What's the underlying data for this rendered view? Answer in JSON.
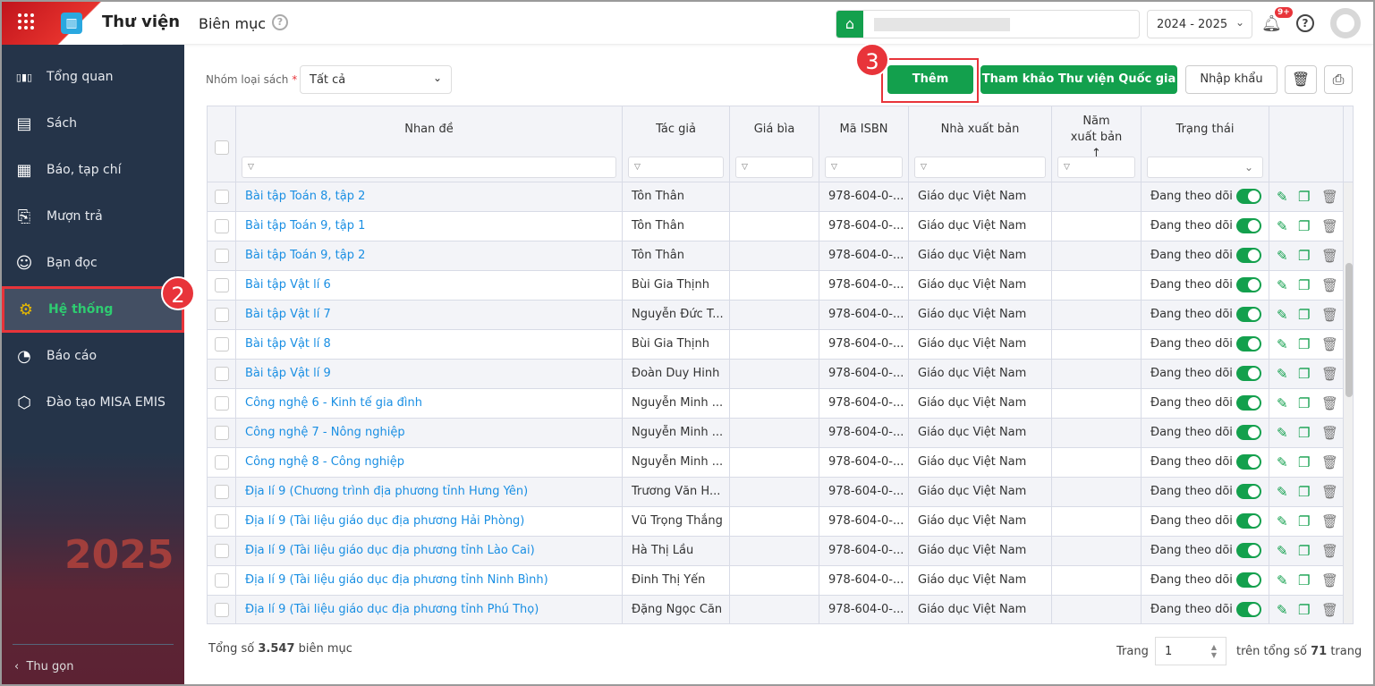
{
  "header": {
    "app_title": "Thư viện",
    "page_title": "Biên mục",
    "school_year": "2024 - 2025",
    "notification_badge": "9+"
  },
  "sidebar": {
    "items": [
      {
        "label": "Tổng quan",
        "icon": "chart-bars-icon"
      },
      {
        "label": "Sách",
        "icon": "book-icon"
      },
      {
        "label": "Báo, tạp chí",
        "icon": "newspaper-icon"
      },
      {
        "label": "Mượn trả",
        "icon": "borrow-icon"
      },
      {
        "label": "Bạn đọc",
        "icon": "reader-icon"
      },
      {
        "label": "Hệ thống",
        "icon": "gear-icon",
        "active": true
      },
      {
        "label": "Báo cáo",
        "icon": "pie-chart-icon"
      },
      {
        "label": "Đào tạo MISA EMIS",
        "icon": "cube-icon"
      }
    ],
    "collapse_label": "Thu gọn"
  },
  "steps": {
    "two": "2",
    "three": "3"
  },
  "toolbar": {
    "filter_label": "Nhóm loại sách",
    "required_mark": "*",
    "filter_value": "Tất cả",
    "add_label": "Thêm",
    "reference_label": "Tham khảo Thư viện Quốc gia",
    "import_label": "Nhập khẩu"
  },
  "table": {
    "columns": [
      "Nhan đề",
      "Tác giả",
      "Giá bìa",
      "Mã ISBN",
      "Nhà xuất bản",
      "Năm xuất bản ↑",
      "Trạng thái"
    ],
    "rows": [
      {
        "title": "Bài tập Toán 8, tập 2",
        "author": "Tôn Thân",
        "price": "",
        "isbn": "978-604-0-...",
        "publisher": "Giáo dục Việt Nam",
        "year": "",
        "status": "Đang theo dõi"
      },
      {
        "title": "Bài tập Toán 9, tập 1",
        "author": "Tôn Thân",
        "price": "",
        "isbn": "978-604-0-...",
        "publisher": "Giáo dục Việt Nam",
        "year": "",
        "status": "Đang theo dõi"
      },
      {
        "title": "Bài tập Toán 9, tập 2",
        "author": "Tôn Thân",
        "price": "",
        "isbn": "978-604-0-...",
        "publisher": "Giáo dục Việt Nam",
        "year": "",
        "status": "Đang theo dõi"
      },
      {
        "title": "Bài tập Vật lí 6",
        "author": "Bùi Gia Thịnh",
        "price": "",
        "isbn": "978-604-0-...",
        "publisher": "Giáo dục Việt Nam",
        "year": "",
        "status": "Đang theo dõi"
      },
      {
        "title": "Bài tập Vật lí 7",
        "author": "Nguyễn Đức T...",
        "price": "",
        "isbn": "978-604-0-...",
        "publisher": "Giáo dục Việt Nam",
        "year": "",
        "status": "Đang theo dõi"
      },
      {
        "title": "Bài tập Vật lí 8",
        "author": "Bùi Gia Thịnh",
        "price": "",
        "isbn": "978-604-0-...",
        "publisher": "Giáo dục Việt Nam",
        "year": "",
        "status": "Đang theo dõi"
      },
      {
        "title": "Bài tập Vật lí 9",
        "author": "Đoàn Duy Hinh",
        "price": "",
        "isbn": "978-604-0-...",
        "publisher": "Giáo dục Việt Nam",
        "year": "",
        "status": "Đang theo dõi"
      },
      {
        "title": "Công nghệ 6 - Kinh tế gia đình",
        "author": "Nguyễn Minh ...",
        "price": "",
        "isbn": "978-604-0-...",
        "publisher": "Giáo dục Việt Nam",
        "year": "",
        "status": "Đang theo dõi"
      },
      {
        "title": "Công nghệ 7 - Nông nghiệp",
        "author": "Nguyễn Minh ...",
        "price": "",
        "isbn": "978-604-0-...",
        "publisher": "Giáo dục Việt Nam",
        "year": "",
        "status": "Đang theo dõi"
      },
      {
        "title": "Công nghệ 8 - Công nghiệp",
        "author": "Nguyễn Minh ...",
        "price": "",
        "isbn": "978-604-0-...",
        "publisher": "Giáo dục Việt Nam",
        "year": "",
        "status": "Đang theo dõi"
      },
      {
        "title": "Địa lí 9 (Chương trình địa phương tỉnh Hưng Yên)",
        "author": "Trương Văn H...",
        "price": "",
        "isbn": "978-604-0-...",
        "publisher": "Giáo dục Việt Nam",
        "year": "",
        "status": "Đang theo dõi"
      },
      {
        "title": "Địa lí 9 (Tài liệu giáo dục địa phương Hải Phòng)",
        "author": "Vũ Trọng Thắng",
        "price": "",
        "isbn": "978-604-0-...",
        "publisher": "Giáo dục Việt Nam",
        "year": "",
        "status": "Đang theo dõi"
      },
      {
        "title": "Địa lí 9 (Tài liệu giáo dục địa phương tỉnh Lào Cai)",
        "author": "Hà Thị Lầu",
        "price": "",
        "isbn": "978-604-0-...",
        "publisher": "Giáo dục Việt Nam",
        "year": "",
        "status": "Đang theo dõi"
      },
      {
        "title": "Địa lí 9 (Tài liệu giáo dục địa phương tỉnh Ninh Bình)",
        "author": "Đinh Thị Yến",
        "price": "",
        "isbn": "978-604-0-...",
        "publisher": "Giáo dục Việt Nam",
        "year": "",
        "status": "Đang theo dõi"
      },
      {
        "title": "Địa lí 9 (Tài liệu giáo dục địa phương tỉnh Phú Thọ)",
        "author": "Đặng Ngọc Căn",
        "price": "",
        "isbn": "978-604-0-...",
        "publisher": "Giáo dục Việt Nam",
        "year": "",
        "status": "Đang theo dõi"
      }
    ]
  },
  "footer": {
    "total_prefix": "Tổng số",
    "total_count": "3.547",
    "total_suffix": "biên mục",
    "page_label": "Trang",
    "page_value": "1",
    "of_prefix": "trên tổng số",
    "total_pages": "71",
    "of_suffix": "trang"
  },
  "colors": {
    "accent": "#13a04d",
    "sidebar": "#253449",
    "link": "#1a8fe3",
    "highlight": "#e8343a"
  }
}
